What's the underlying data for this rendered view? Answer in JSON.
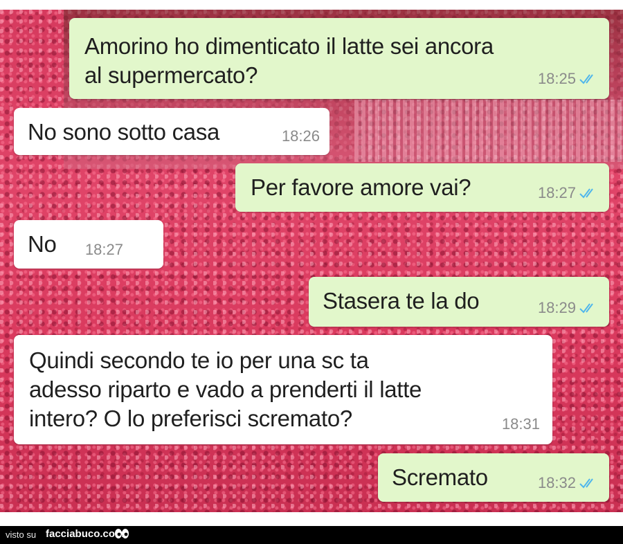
{
  "chat": {
    "messages": [
      {
        "direction": "outgoing",
        "text": "Amorino ho dimenticato il latte sei ancora\nal supermercato?",
        "time": "18:25",
        "status": "read-ticks-icon"
      },
      {
        "direction": "incoming",
        "text": "No sono sotto casa",
        "time": "18:26"
      },
      {
        "direction": "outgoing",
        "text": "Per favore amore vai?",
        "time": "18:27",
        "status": "read-ticks-icon"
      },
      {
        "direction": "incoming",
        "text": "No",
        "time": "18:27"
      },
      {
        "direction": "outgoing",
        "text": "Stasera te la do",
        "time": "18:29",
        "status": "read-ticks-icon"
      },
      {
        "direction": "incoming",
        "text": "Quindi secondo te io per una sc    ta\nadesso riparto e vado a prenderti il latte\nintero? O lo preferisci scremato?",
        "time": "18:31"
      },
      {
        "direction": "outgoing",
        "text": "Scremato",
        "time": "18:32",
        "status": "read-ticks-icon"
      }
    ]
  },
  "footer": {
    "visto": "visto su",
    "site": "facciabuco.com",
    "logo_icon": "eyes-icon"
  },
  "colors": {
    "outgoing_bubble": "#e2f7cb",
    "incoming_bubble": "#ffffff",
    "read_ticks": "#4fb6ec",
    "background": "#d63a5e"
  }
}
